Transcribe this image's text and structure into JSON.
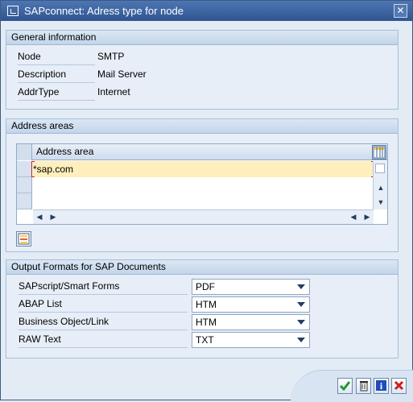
{
  "window": {
    "title": "SAPconnect: Adress type for node",
    "close_symbol": "✕"
  },
  "general": {
    "title": "General information",
    "fields": [
      {
        "label": "Node",
        "value": "SMTP"
      },
      {
        "label": "Description",
        "value": "Mail Server"
      },
      {
        "label": "AddrType",
        "value": "Internet"
      }
    ]
  },
  "address_areas": {
    "title": "Address areas",
    "column_header": "Address area",
    "rows": [
      "*sap.com",
      "",
      ""
    ]
  },
  "output_formats": {
    "title": "Output Formats for SAP Documents",
    "rows": [
      {
        "label": "SAPscript/Smart Forms",
        "value": "PDF"
      },
      {
        "label": "ABAP List",
        "value": "HTM"
      },
      {
        "label": "Business Object/Link",
        "value": "HTM"
      },
      {
        "label": "RAW Text",
        "value": "TXT"
      }
    ]
  },
  "buttons": {
    "ok_icon": "check-icon",
    "delete_icon": "trash-icon",
    "info_icon": "info-icon",
    "cancel_icon": "cancel-icon"
  },
  "colors": {
    "title_bar": "#315893",
    "selected_row": "#ffefbc",
    "required_marker": "#cc1d1d"
  }
}
